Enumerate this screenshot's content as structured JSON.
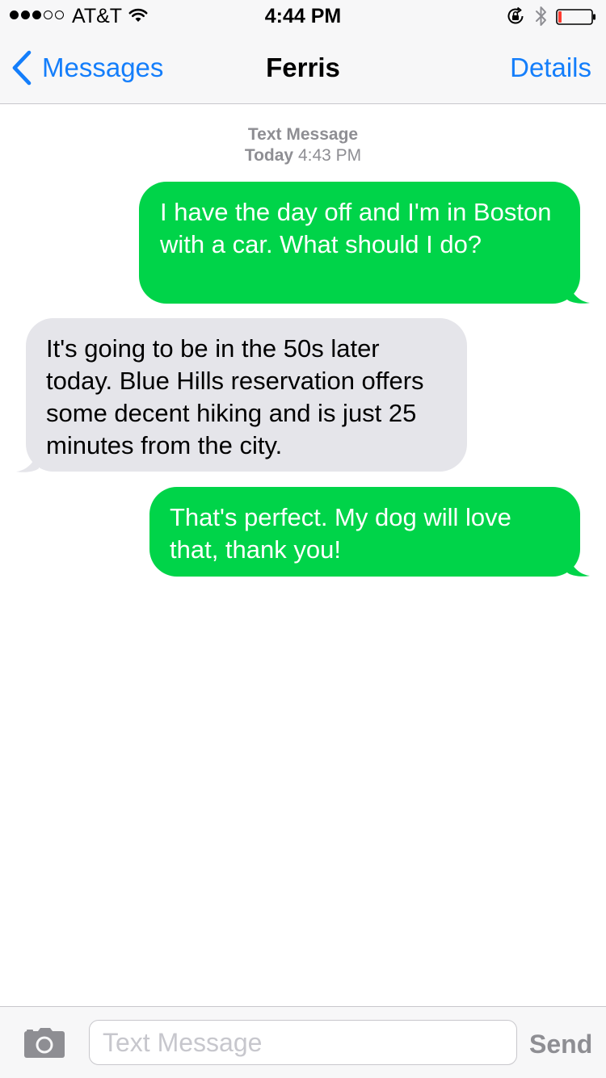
{
  "status_bar": {
    "signal_bars_filled": 3,
    "signal_bars_total": 5,
    "carrier": "AT&T",
    "time": "4:44 PM",
    "icons": [
      "wifi-icon",
      "rotation-lock-icon",
      "bluetooth-icon",
      "battery-icon"
    ],
    "battery_level": 0.1,
    "battery_color": "#ff3b30"
  },
  "nav": {
    "back_label": "Messages",
    "title": "Ferris",
    "details_label": "Details"
  },
  "thread": {
    "timestamp": {
      "type": "Text Message",
      "day": "Today",
      "time": "4:43 PM"
    },
    "messages": [
      {
        "direction": "outgoing",
        "text": "I have the day off and I'm in Boston with a car. What should I do?"
      },
      {
        "direction": "incoming",
        "text": "It's going to be in the 50s later today. Blue Hills reservation offers some decent hiking and is just 25 minutes from the city."
      },
      {
        "direction": "outgoing",
        "text": "That's perfect. My dog will love that, thank you!"
      }
    ]
  },
  "input_bar": {
    "camera_icon": "camera-icon",
    "placeholder": "Text Message",
    "value": "",
    "send_label": "Send"
  },
  "colors": {
    "accent": "#147efb",
    "outgoing_bubble": "#00d449",
    "incoming_bubble": "#e5e5ea",
    "muted_text": "#8e8e93"
  }
}
